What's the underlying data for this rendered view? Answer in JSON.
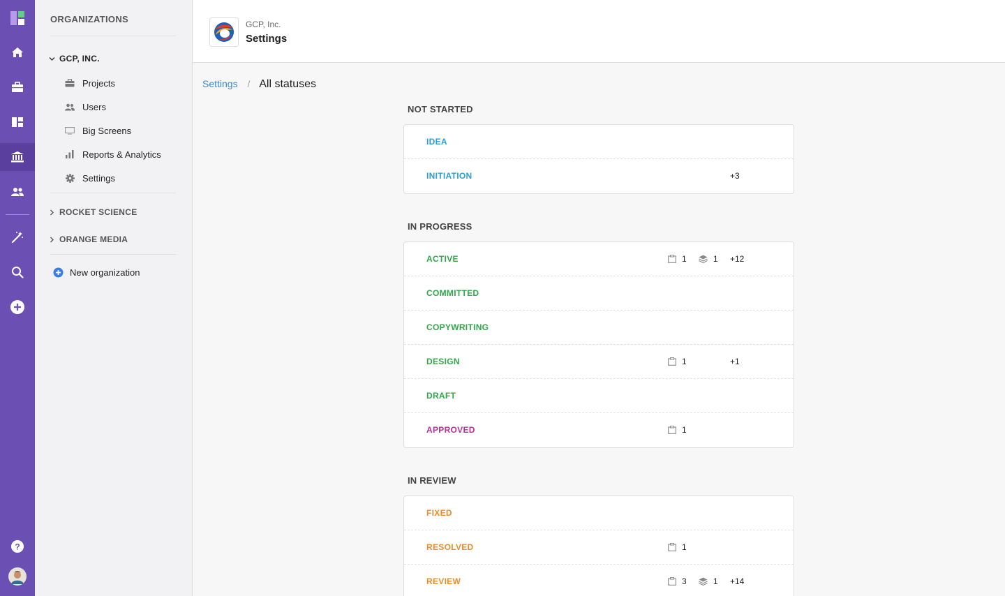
{
  "rail": {
    "icons": [
      "app-logo-icon",
      "home-icon",
      "briefcase-icon",
      "dashboard-icon",
      "bank-icon",
      "users-icon",
      "magic-wand-icon",
      "search-icon",
      "plus-circle-icon",
      "help-icon",
      "avatar"
    ]
  },
  "sidebar": {
    "heading": "ORGANIZATIONS",
    "current_org": "GCP, INC.",
    "items": [
      {
        "label": "Projects",
        "icon": "briefcase-icon"
      },
      {
        "label": "Users",
        "icon": "users-icon"
      },
      {
        "label": "Big Screens",
        "icon": "monitor-icon"
      },
      {
        "label": "Reports & Analytics",
        "icon": "bar-chart-icon"
      },
      {
        "label": "Settings",
        "icon": "gear-icon"
      }
    ],
    "other_orgs": [
      "ROCKET SCIENCE",
      "ORANGE MEDIA"
    ],
    "new_org": "New organization"
  },
  "header": {
    "org": "GCP, Inc.",
    "title": "Settings"
  },
  "breadcrumb": {
    "link": "Settings",
    "separator": "/",
    "current": "All statuses"
  },
  "groups": [
    {
      "title": "NOT STARTED",
      "statuses": [
        {
          "label": "IDEA",
          "color": "#2a9fd6"
        },
        {
          "label": "INITIATION",
          "color": "#2a9fd6",
          "extra": "+3"
        }
      ]
    },
    {
      "title": "IN PROGRESS",
      "statuses": [
        {
          "label": "ACTIVE",
          "color": "#2fa84a",
          "projects": "1",
          "layers": "1",
          "extra": "+12"
        },
        {
          "label": "COMMITTED",
          "color": "#2fa84a"
        },
        {
          "label": "COPYWRITING",
          "color": "#2fa84a"
        },
        {
          "label": "DESIGN",
          "color": "#2fa84a",
          "projects": "1",
          "extra": "+1"
        },
        {
          "label": "DRAFT",
          "color": "#2fa84a"
        },
        {
          "label": "APPROVED",
          "color": "#b8309a",
          "projects": "1"
        }
      ]
    },
    {
      "title": "IN REVIEW",
      "statuses": [
        {
          "label": "FIXED",
          "color": "#ef8c24"
        },
        {
          "label": "RESOLVED",
          "color": "#ef8c24",
          "projects": "1"
        },
        {
          "label": "REVIEW",
          "color": "#ef8c24",
          "projects": "3",
          "layers": "1",
          "extra": "+14"
        }
      ]
    }
  ],
  "colors": {
    "rail": "#6c4fb3",
    "link": "#3a88c8"
  }
}
